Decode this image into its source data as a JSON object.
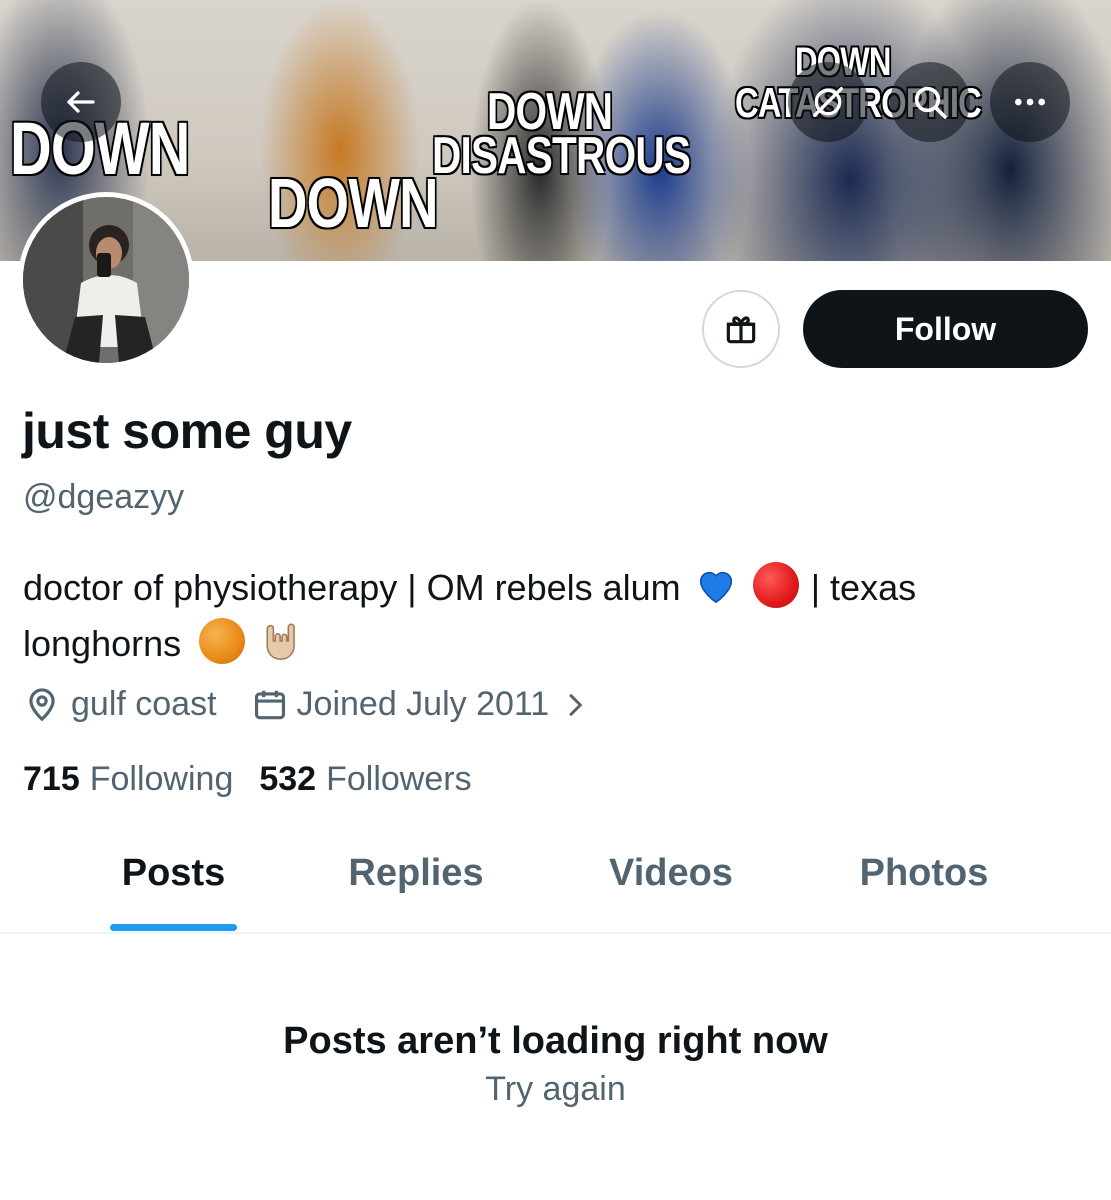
{
  "banner": {
    "captions": [
      "DOWN",
      "DOWN",
      "DISASTROUS",
      "DOWN",
      "CATASTROPHIC",
      "DOWN"
    ]
  },
  "header": {
    "back_icon": "arrow-left-icon",
    "hide_icon": "eye-off-icon",
    "search_icon": "search-icon",
    "more_icon": "more-horizontal-icon"
  },
  "profile": {
    "display_name": "just some guy",
    "handle": "@dgeazyy",
    "bio_text_1": "doctor of physiotherapy | OM rebels alum",
    "bio_text_2": "| texas",
    "bio_text_3": "longhorns",
    "location": "gulf coast",
    "joined": "Joined July 2011",
    "following_count": "715",
    "following_label": "Following",
    "followers_count": "532",
    "followers_label": "Followers"
  },
  "actions": {
    "gift_icon": "gift-icon",
    "follow_label": "Follow"
  },
  "tabs": [
    {
      "label": "Posts"
    },
    {
      "label": "Replies"
    },
    {
      "label": "Videos"
    },
    {
      "label": "Photos"
    }
  ],
  "empty_state": {
    "title": "Posts aren’t loading right now",
    "retry_label": "Try again"
  },
  "colors": {
    "text_primary": "#0f1419",
    "text_secondary": "#536471",
    "accent": "#1d9bf0",
    "follow_bg": "#0f1419"
  }
}
